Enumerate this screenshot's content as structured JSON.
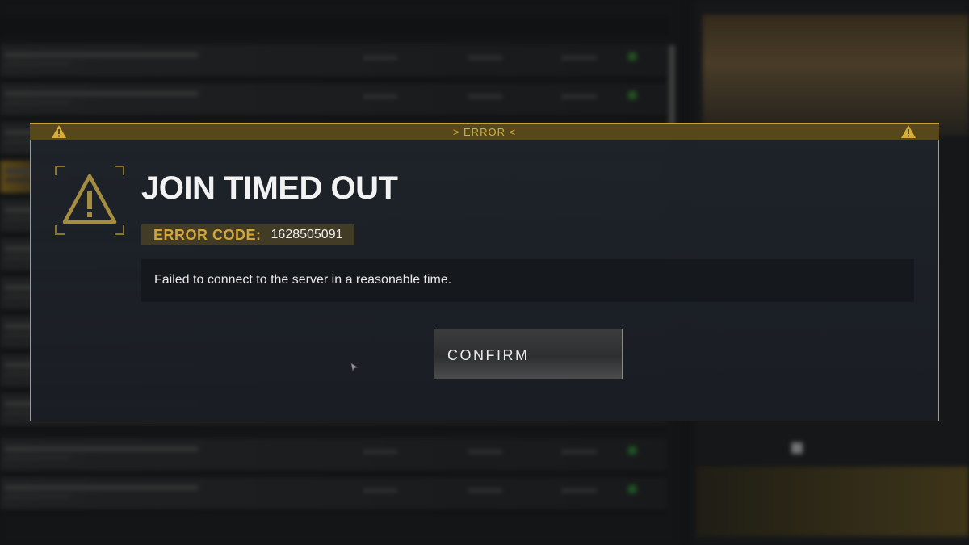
{
  "dialog": {
    "header_label": "> ERROR <",
    "title": "JOIN TIMED OUT",
    "error_code_label": "ERROR CODE:",
    "error_code_value": "1628505091",
    "message": "Failed to connect to the server in a reasonable time.",
    "confirm_label": "CONFIRM"
  },
  "icons": {
    "header_left": "warning-icon",
    "header_right": "warning-icon",
    "dialog": "warning-icon",
    "cursor": "mouse-cursor-icon"
  },
  "colors": {
    "accent_gold": "#c9a233",
    "header_bg": "#57481b",
    "dialog_bg": "#1e232a",
    "code_label": "#d1a63a"
  }
}
